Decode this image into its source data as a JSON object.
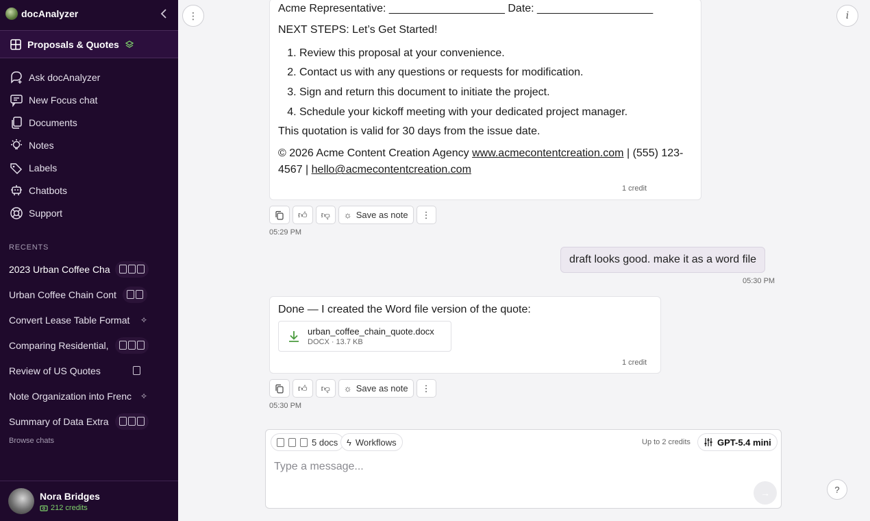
{
  "sidebar": {
    "brand": "docAnalyzer",
    "project": "Proposals & Quotes",
    "nav": [
      {
        "label": "Ask docAnalyzer",
        "icon": "chat-plus-icon"
      },
      {
        "label": "New Focus chat",
        "icon": "focus-chat-icon"
      },
      {
        "label": "Documents",
        "icon": "documents-icon"
      },
      {
        "label": "Notes",
        "icon": "lightbulb-icon"
      },
      {
        "label": "Labels",
        "icon": "tags-icon"
      },
      {
        "label": "Chatbots",
        "icon": "robot-icon"
      },
      {
        "label": "Support",
        "icon": "lifebuoy-icon"
      }
    ],
    "recents_title": "RECENTS",
    "recents": [
      {
        "label": "2023 Urban Coffee Cha"
      },
      {
        "label": "Urban Coffee Chain Cont"
      },
      {
        "label": "Convert Lease Table Format"
      },
      {
        "label": "Comparing Residential,"
      },
      {
        "label": "Review of US Quotes"
      },
      {
        "label": "Note Organization into Frenc"
      },
      {
        "label": "Summary of Data Extra"
      }
    ],
    "browse": "Browse chats",
    "user": {
      "name": "Nora Bridges",
      "credits": "212 credits"
    }
  },
  "chat": {
    "msg1": {
      "signature_line": "Acme Representative: ___________________ Date: ___________________",
      "next_steps_title": "NEXT STEPS: Let’s Get Started!",
      "steps": [
        "Review this proposal at your convenience.",
        "Contact us with any questions or requests for modification.",
        "Sign and return this document to initiate the project.",
        "Schedule your kickoff meeting with your dedicated project manager."
      ],
      "validity": "This quotation is valid for 30 days from the issue date.",
      "footer_prefix": "© 2026 Acme Content Creation Agency ",
      "footer_link": "www.acmecontentcreation.com",
      "footer_phone": " | (555) 123-4567 | ",
      "footer_email": "hello@acmecontentcreation.com",
      "credit": "1 credit",
      "time": "05:29 PM"
    },
    "user_msg": {
      "text": "draft looks good. make it as a word file",
      "time": "05:30 PM"
    },
    "msg2": {
      "text": "Done — I created the Word file version of the quote:",
      "file_name": "urban_coffee_chain_quote.docx",
      "file_meta": "DOCX · 13.7 KB",
      "credit": "1 credit",
      "time": "05:30 PM"
    },
    "actions": {
      "save_note": "Save as note"
    }
  },
  "composer": {
    "docs": "5 docs",
    "workflows": "Workflows",
    "credits_note": "Up to 2 credits",
    "model": "GPT-5.4 mini",
    "placeholder": "Type a message..."
  }
}
